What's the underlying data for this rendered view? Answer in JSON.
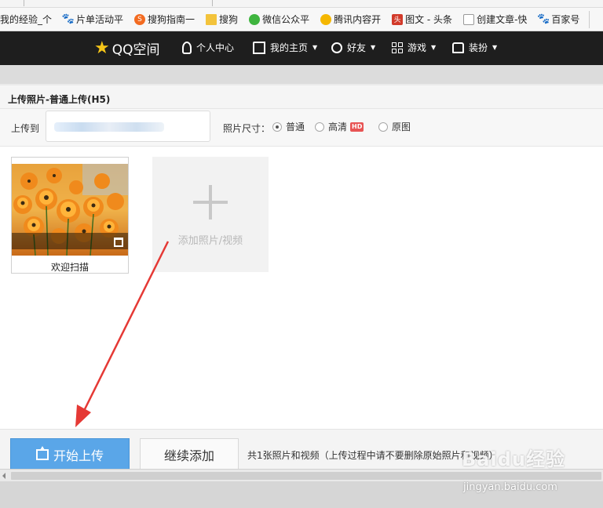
{
  "bookmarks": [
    {
      "icon": "none",
      "label": "我的经验_个"
    },
    {
      "icon": "paw-icon",
      "label": "片单活动平"
    },
    {
      "icon": "sogou-icon",
      "label": "搜狗指南一"
    },
    {
      "icon": "folder-icon",
      "label": "搜狗"
    },
    {
      "icon": "wechat-icon",
      "label": "微信公众平"
    },
    {
      "icon": "tencent-icon",
      "label": "腾讯内容开"
    },
    {
      "icon": "toutiao-icon",
      "label": "图文 - 头条"
    },
    {
      "icon": "doc-icon",
      "label": "创建文章-快"
    },
    {
      "icon": "paw-icon",
      "label": "百家号"
    }
  ],
  "header": {
    "logo_text": "QQ空间",
    "nav": [
      {
        "label": "个人中心",
        "icon": "user-icon",
        "dropdown": false
      },
      {
        "label": "我的主页",
        "icon": "home-icon",
        "dropdown": true
      },
      {
        "label": "好友",
        "icon": "friends-icon",
        "dropdown": true
      },
      {
        "label": "游戏",
        "icon": "games-icon",
        "dropdown": true
      },
      {
        "label": "装扮",
        "icon": "shirt-icon",
        "dropdown": true
      }
    ]
  },
  "dialog": {
    "title": "上传照片-普通上传(H5)",
    "upload_to_label": "上传到",
    "photo_size_label": "照片尺寸：",
    "size_options": [
      {
        "label": "普通",
        "selected": true
      },
      {
        "label": "高清",
        "selected": false,
        "badge": "HD"
      },
      {
        "label": "原图",
        "selected": false
      }
    ]
  },
  "photos": [
    {
      "caption": "欢迎扫描"
    }
  ],
  "add_tile_label": "添加照片/视频",
  "actions": {
    "start_label": "开始上传",
    "continue_label": "继续添加",
    "note": "共1张照片和视频（上传过程中请不要删除原始照片和视频）"
  },
  "watermark": {
    "main": "Baidu经验",
    "sub": "jingyan.baidu.com"
  },
  "colors": {
    "primary_button": "#5aa6e8",
    "header_bg": "#1e1e1e",
    "hd_badge": "#e85454",
    "annotation_arrow": "#e53935"
  }
}
